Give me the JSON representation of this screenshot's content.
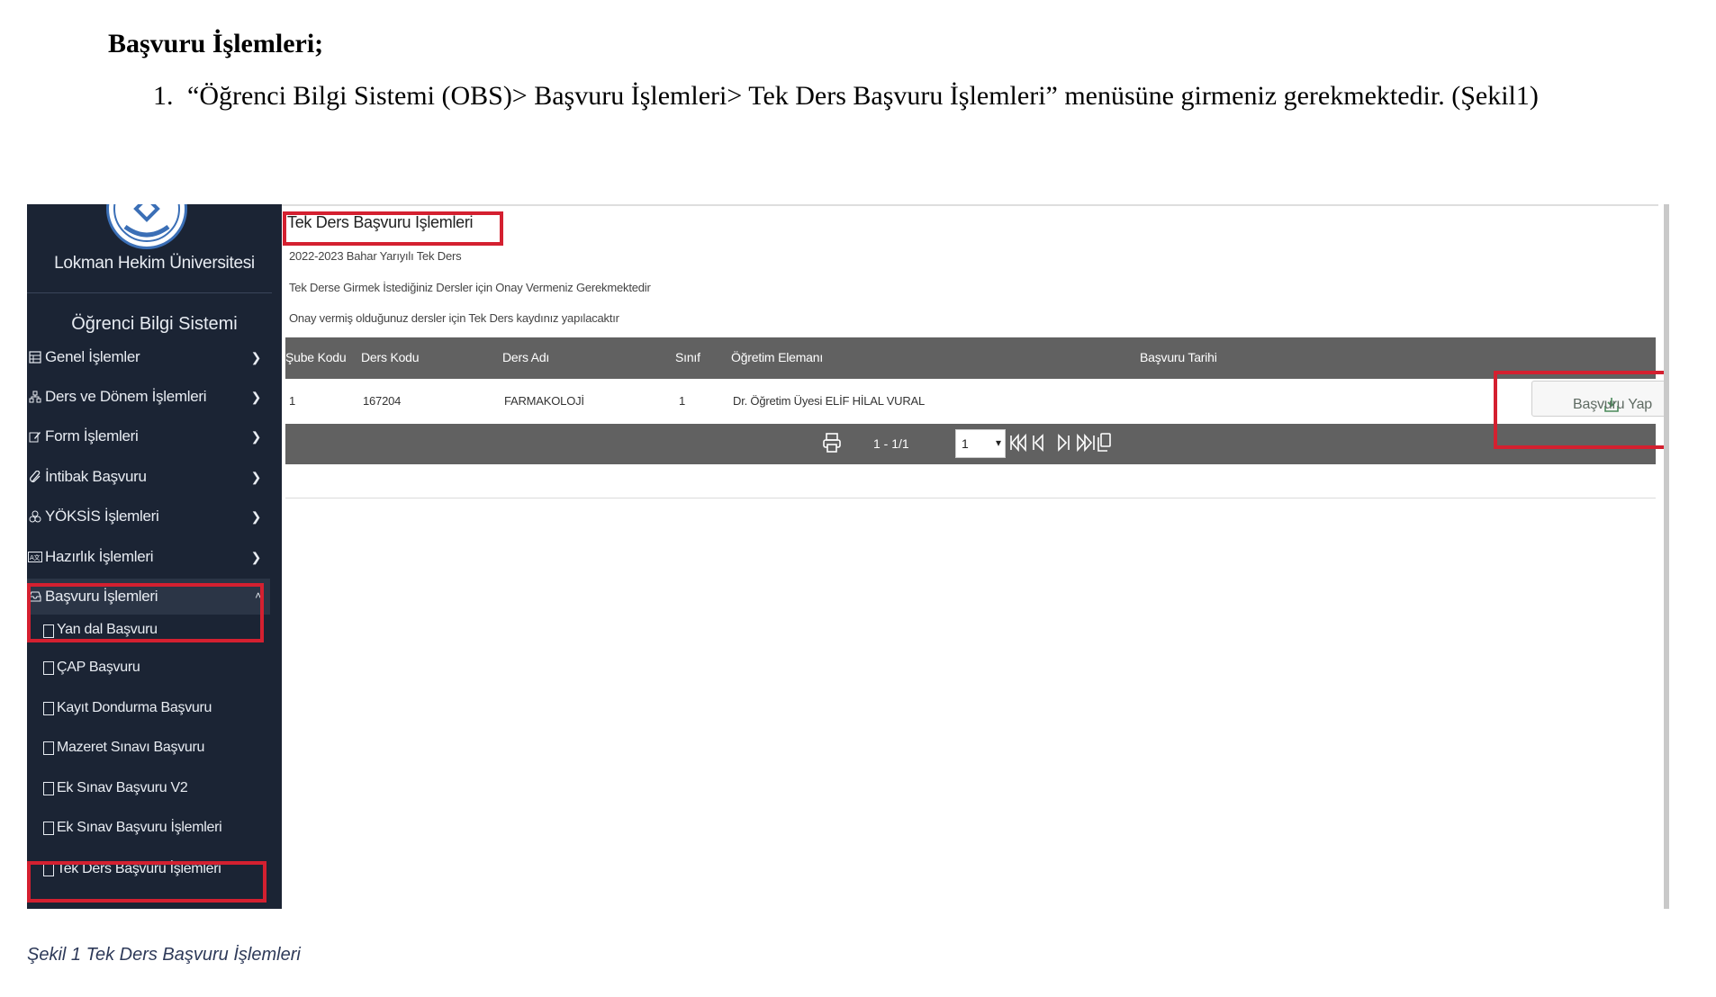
{
  "document": {
    "heading": "Başvuru İşlemleri;",
    "step_number": "1.",
    "step_text": "“Öğrenci Bilgi Sistemi (OBS)> Başvuru İşlemleri> Tek Ders Başvuru İşlemleri” menüsüne girmeniz gerekmektedir. (Şekil1)",
    "caption": "Şekil 1 Tek Ders Başvuru İşlemleri"
  },
  "sidebar": {
    "university": "Lokman Hekim Üniversitesi",
    "system": "Öğrenci Bilgi Sistemi",
    "items": [
      {
        "label": "Genel İşlemler",
        "icon": "table-icon"
      },
      {
        "label": "Ders ve Dönem İşlemleri",
        "icon": "sitemap-icon"
      },
      {
        "label": "Form İşlemleri",
        "icon": "edit-icon"
      },
      {
        "label": "İntibak Başvuru",
        "icon": "paperclip-icon"
      },
      {
        "label": "YÖKSİS İşlemleri",
        "icon": "cubes-icon"
      },
      {
        "label": "Hazırlık İşlemleri",
        "icon": "language-icon"
      },
      {
        "label": "Başvuru İşlemleri",
        "icon": "inbox-icon"
      }
    ],
    "subitems": [
      "Yan dal Başvuru",
      "ÇAP Başvuru",
      "Kayıt Dondurma Başvuru",
      "Mazeret Sınavı Başvuru",
      "Ek Sınav Başvuru V2",
      "Ek Sınav Başvuru İşlemleri",
      "Tek Ders Başvuru İşlemleri"
    ]
  },
  "main": {
    "title": "Tek Ders Başvuru İşlemleri",
    "term": "2022-2023 Bahar Yarıyılı Tek Ders",
    "info1": "Tek Derse Girmek İstediğiniz Dersler için Onay Vermeniz Gerekmektedir",
    "info2": "Onay vermiş olduğunuz dersler için Tek Ders kaydınız yapılacaktır",
    "columns": [
      "Şube Kodu",
      "Ders Kodu",
      "Ders Adı",
      "Sınıf",
      "Öğretim Elemanı",
      "Başvuru Tarihi"
    ],
    "row": [
      "1",
      "167204",
      "FARMAKOLOJİ",
      "1",
      "Dr. Öğretim Üyesi ELİF HİLAL VURAL",
      ""
    ],
    "apply_button": "Başvuru Yap",
    "pager_range": "1 - 1/1",
    "page_selected": "1"
  },
  "colors": {
    "sidebar_bg": "#1b2434",
    "table_header_bg": "#616161",
    "highlight": "#d42030",
    "caption": "#2e3a59"
  }
}
